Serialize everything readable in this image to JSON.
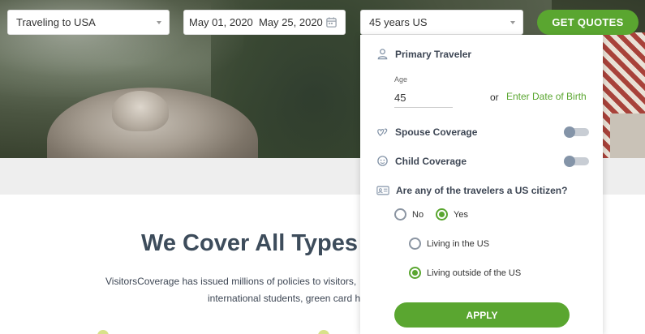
{
  "search": {
    "destination": "Traveling to USA",
    "start_date": "May 01, 2020",
    "end_date": "May 25, 2020",
    "travelers": "45 years US",
    "get_quotes_label": "GET QUOTES"
  },
  "panel": {
    "primary_traveler_label": "Primary Traveler",
    "age_label": "Age",
    "age_value": "45",
    "or_text": "or",
    "dob_link": "Enter Date of Birth",
    "spouse_label": "Spouse Coverage",
    "spouse_on": false,
    "child_label": "Child Coverage",
    "child_on": false,
    "citizen_question": "Are any of the travelers a US citizen?",
    "citizen_options": [
      "No",
      "Yes"
    ],
    "citizen_selected": "Yes",
    "residence_options": [
      "Living in the US",
      "Living outside of the US"
    ],
    "residence_selected": "Living outside of the US",
    "apply_label": "APPLY"
  },
  "page": {
    "title": "We Cover All Types o",
    "description_line1": "VisitorsCoverage has issued millions of policies to visitors,",
    "description_line2": "international students, green card h"
  },
  "colors": {
    "accent": "#5aa630",
    "heading": "#3d4c5b",
    "toggle_knob": "#8494a8"
  }
}
